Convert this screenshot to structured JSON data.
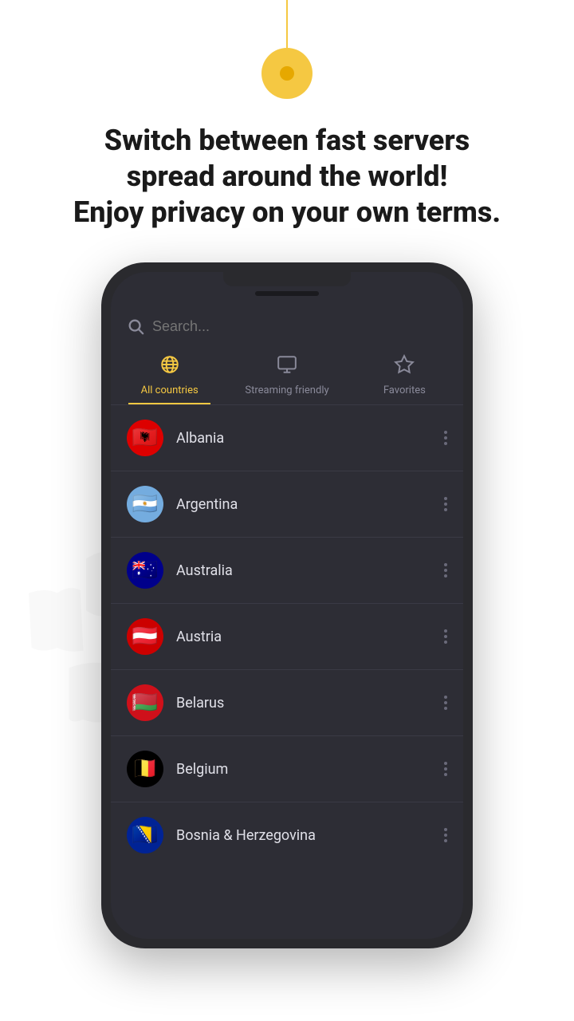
{
  "header": {
    "headline_line1": "Switch between fast servers",
    "headline_line2": "spread around the world!",
    "headline_line3": "Enjoy privacy on your own terms."
  },
  "search": {
    "placeholder": "Search..."
  },
  "tabs": [
    {
      "id": "all-countries",
      "label": "All countries",
      "icon": "globe",
      "active": true
    },
    {
      "id": "streaming-friendly",
      "label": "Streaming friendly",
      "icon": "monitor",
      "active": false
    },
    {
      "id": "favorites",
      "label": "Favorites",
      "icon": "star",
      "active": false
    }
  ],
  "countries": [
    {
      "name": "Albania",
      "flag_emoji": "🇦🇱",
      "flag_class": "flag-albania"
    },
    {
      "name": "Argentina",
      "flag_emoji": "🇦🇷",
      "flag_class": "flag-argentina"
    },
    {
      "name": "Australia",
      "flag_emoji": "🇦🇺",
      "flag_class": "flag-australia"
    },
    {
      "name": "Austria",
      "flag_emoji": "🇦🇹",
      "flag_class": "flag-austria"
    },
    {
      "name": "Belarus",
      "flag_emoji": "🇧🇾",
      "flag_class": "flag-belarus"
    },
    {
      "name": "Belgium",
      "flag_emoji": "🇧🇪",
      "flag_class": "flag-belgium"
    },
    {
      "name": "Bosnia & Herzegovina",
      "flag_emoji": "🇧🇦",
      "flag_class": "flag-bosnia"
    }
  ]
}
